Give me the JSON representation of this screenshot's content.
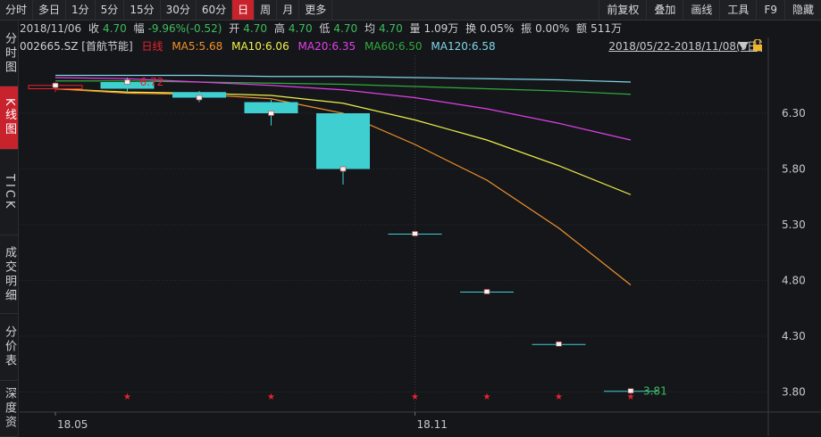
{
  "toolbar": {
    "periods": [
      "分时",
      "多日",
      "1分",
      "5分",
      "15分",
      "30分",
      "60分",
      "日",
      "周",
      "月",
      "更多"
    ],
    "active_period": "日",
    "right_buttons": [
      "前复权",
      "叠加",
      "画线",
      "工具",
      "F9",
      "隐藏"
    ]
  },
  "info": {
    "date": "2018/11/06",
    "close_label": "收",
    "close": "4.70",
    "change_label": "幅",
    "change": "-9.96%(-0.52)",
    "open_label": "开",
    "open": "4.70",
    "high_label": "高",
    "high": "4.70",
    "low_label": "低",
    "low": "4.70",
    "avg_label": "均",
    "avg": "4.70",
    "volume_label": "量",
    "volume": "1.09万",
    "turnover_label": "换",
    "turnover": "0.05%",
    "amplitude_label": "振",
    "amplitude": "0.00%",
    "amount_label": "额",
    "amount": "511万"
  },
  "sidebar": {
    "tabs": [
      "分时图",
      "K线图",
      "TICK",
      "成交明细",
      "分价表",
      "深度资"
    ],
    "active": "K线图"
  },
  "legend": {
    "code": "002665.SZ [首航节能]",
    "period": "日线",
    "ma5": "MA5:5.68",
    "ma10": "MA10:6.06",
    "ma20": "MA20:6.35",
    "ma60": "MA60:6.50",
    "ma120": "MA120:6.58"
  },
  "range_text": "2018/05/22-2018/11/08(9日)",
  "colors": {
    "up": "#e8232e",
    "down": "#3fcfd0",
    "ma5": "#f0922b",
    "ma10": "#f2f24a",
    "ma20": "#e040e8",
    "ma60": "#2faa3d",
    "ma120": "#7fd6e8",
    "grid": "#2a2b30"
  },
  "chart_data": {
    "type": "candlestick",
    "y_ticks": [
      6.3,
      5.8,
      5.3,
      4.8,
      4.3,
      3.8
    ],
    "ylim": [
      3.62,
      6.82
    ],
    "x_labels": [
      {
        "text": "18.05",
        "index": 0
      },
      {
        "text": "18.11",
        "index": 5
      }
    ],
    "candles": [
      {
        "open": 6.52,
        "close": 6.55,
        "high": 6.58,
        "low": 6.49,
        "dir": "up"
      },
      {
        "open": 6.52,
        "close": 6.58,
        "high": 6.62,
        "low": 6.49,
        "dir": "down"
      },
      {
        "open": 6.49,
        "close": 6.44,
        "high": 6.5,
        "low": 6.4,
        "dir": "down"
      },
      {
        "open": 6.4,
        "close": 6.3,
        "high": 6.42,
        "low": 6.19,
        "dir": "down"
      },
      {
        "open": 6.3,
        "close": 5.8,
        "high": 6.3,
        "low": 5.66,
        "dir": "down"
      },
      {
        "open": 5.22,
        "close": 5.22,
        "high": 5.22,
        "low": 5.22,
        "dir": "down"
      },
      {
        "open": 4.7,
        "close": 4.7,
        "high": 4.7,
        "low": 4.7,
        "dir": "down"
      },
      {
        "open": 4.23,
        "close": 4.23,
        "high": 4.23,
        "low": 4.23,
        "dir": "down"
      },
      {
        "open": 3.81,
        "close": 3.81,
        "high": 3.81,
        "low": 3.81,
        "dir": "down"
      }
    ],
    "annotations": [
      {
        "text": "6.72",
        "index": 1,
        "value": 6.58,
        "color": "#e8232e"
      },
      {
        "text": "3.81",
        "index": 8,
        "value": 3.81,
        "color": "#3dbd5b"
      }
    ],
    "ma_lines": {
      "ma5": [
        6.52,
        6.48,
        6.47,
        6.43,
        6.3,
        6.02,
        5.7,
        5.27,
        4.76
      ],
      "ma10": [
        6.52,
        6.49,
        6.48,
        6.46,
        6.39,
        6.24,
        6.06,
        5.83,
        5.57
      ],
      "ma20": [
        6.62,
        6.61,
        6.58,
        6.55,
        6.51,
        6.44,
        6.34,
        6.21,
        6.06
      ],
      "ma60": [
        6.59,
        6.59,
        6.58,
        6.57,
        6.56,
        6.54,
        6.52,
        6.5,
        6.47
      ],
      "ma120": [
        6.64,
        6.64,
        6.64,
        6.63,
        6.63,
        6.62,
        6.61,
        6.6,
        6.58
      ]
    },
    "marker_row": [
      false,
      true,
      false,
      true,
      false,
      true,
      true,
      true,
      true
    ]
  }
}
